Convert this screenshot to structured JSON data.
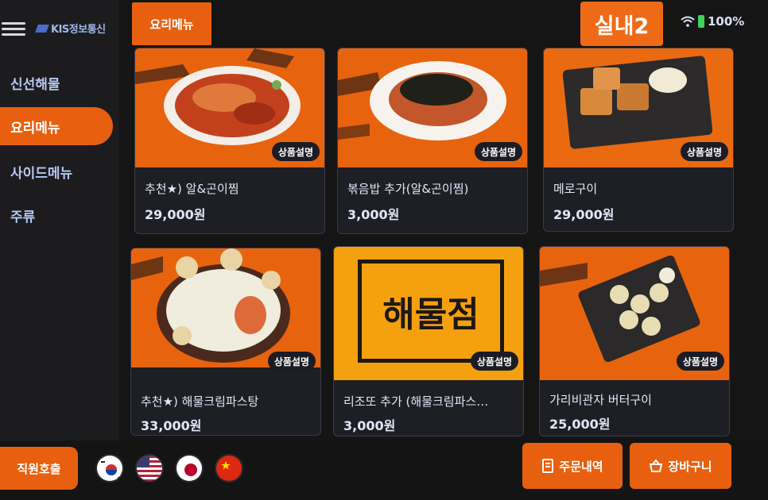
{
  "sidebar": {
    "brand": "KIS정보통신",
    "items": [
      {
        "label": "신선해물",
        "active": false
      },
      {
        "label": "요리메뉴",
        "active": true
      },
      {
        "label": "사이드메뉴",
        "active": false
      },
      {
        "label": "주류",
        "active": false
      }
    ]
  },
  "header": {
    "category_tab": "요리메뉴",
    "table_label": "실내2",
    "battery_level": "100%"
  },
  "menu": {
    "desc_label": "상품설명",
    "items": [
      {
        "name": "추천★) 알&곤이찜",
        "price": "29,000원"
      },
      {
        "name": "볶음밥 추가(알&곤이찜)",
        "price": "3,000원"
      },
      {
        "name": "메로구이",
        "price": "29,000원"
      },
      {
        "name": "추천★) 해물크림파스탕",
        "price": "33,000원"
      },
      {
        "name": "리조또 추가 (해물크림파스…",
        "price": "3,000원",
        "image_text": "해물점"
      },
      {
        "name": "가리비관자 버터구이",
        "price": "25,000원"
      }
    ]
  },
  "footer": {
    "staff_call": "직원호출",
    "languages": [
      "korean-flag",
      "usa-flag",
      "japan-flag",
      "china-flag"
    ],
    "order_history": "주문내역",
    "cart": "장바구니"
  },
  "colors": {
    "accent": "#e8600f",
    "card_bg": "#1e1e25",
    "text": "#e3e7f7",
    "nav_text": "#b7c7f0"
  }
}
